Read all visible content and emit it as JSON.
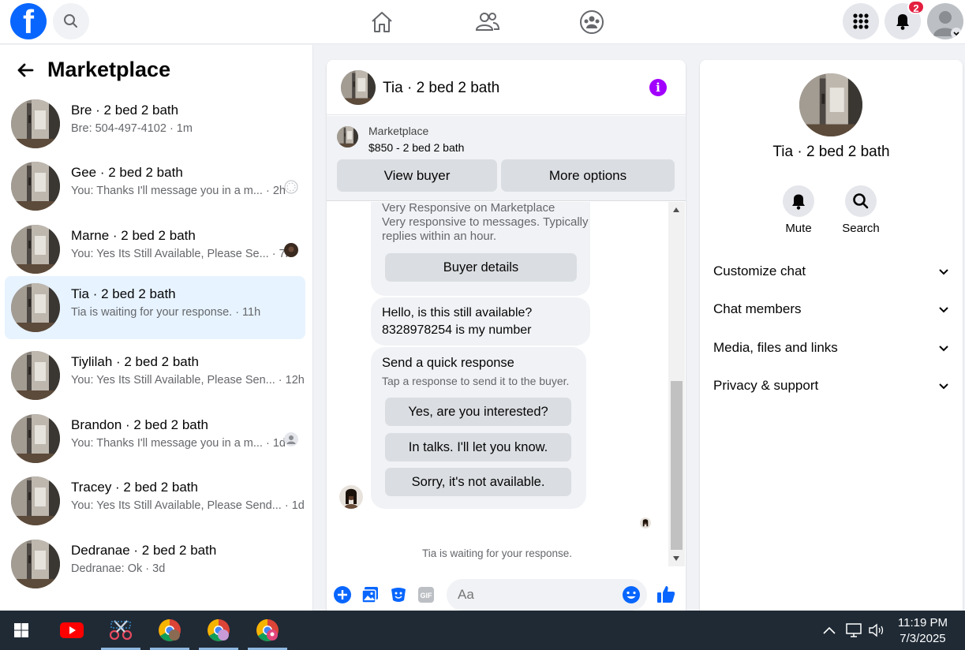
{
  "nav": {
    "logo": "f",
    "notification_count": "2"
  },
  "sidebar": {
    "title": "Marketplace",
    "conversations": [
      {
        "name": "Bre · 2 bed 2 bath",
        "snippet": "Bre: 504-497-4102 · 1m"
      },
      {
        "name": "Gee · 2 bed 2 bath",
        "snippet": "You: Thanks I'll message you in a m... · 2h"
      },
      {
        "name": "Marne · 2 bed 2 bath",
        "snippet": "You: Yes Its Still Available, Please Se... · 7h"
      },
      {
        "name": "Tia · 2 bed 2 bath",
        "snippet": "Tia is waiting for your response. · 11h"
      },
      {
        "name": "Tiylilah · 2 bed 2 bath",
        "snippet": "You: Yes Its Still Available, Please Sen... · 12h"
      },
      {
        "name": "Brandon · 2 bed 2 bath",
        "snippet": "You: Thanks I'll message you in a m... · 1d"
      },
      {
        "name": "Tracey · 2 bed 2 bath",
        "snippet": "You: Yes Its Still Available, Please Send... · 1d"
      },
      {
        "name": "Dedranae · 2 bed 2 bath",
        "snippet": "Dedranae: Ok · 3d"
      }
    ]
  },
  "chat": {
    "title": "Tia · 2 bed 2 bath",
    "marketplace_label": "Marketplace",
    "listing": "$850 - 2 bed 2 bath",
    "view_buyer": "View buyer",
    "more_options": "More options",
    "responsive_title": "Very Responsive on Marketplace",
    "responsive_line1": "Very responsive to messages. Typically",
    "responsive_line2": "replies within an hour.",
    "buyer_details": "Buyer details",
    "message_line1": "Hello, is this still available?",
    "message_line2": "8328978254 is my number",
    "quick_title": "Send a quick response",
    "quick_sub": "Tap a response to send it to the buyer.",
    "quick_responses": [
      "Yes, are you interested?",
      "In talks. I'll let you know.",
      "Sorry, it's not available."
    ],
    "waiting": "Tia is waiting for your response.",
    "composer_placeholder": "Aa"
  },
  "details": {
    "title": "Tia · 2 bed 2 bath",
    "mute": "Mute",
    "search": "Search",
    "sections": [
      "Customize chat",
      "Chat members",
      "Media, files and links",
      "Privacy & support"
    ]
  },
  "taskbar": {
    "time": "11:19 PM",
    "date": "7/3/2025"
  },
  "colors": {
    "brand": "#0866ff",
    "active_conv": "#e7f3ff",
    "info": "#a100ff",
    "badge": "#e41e3f"
  }
}
